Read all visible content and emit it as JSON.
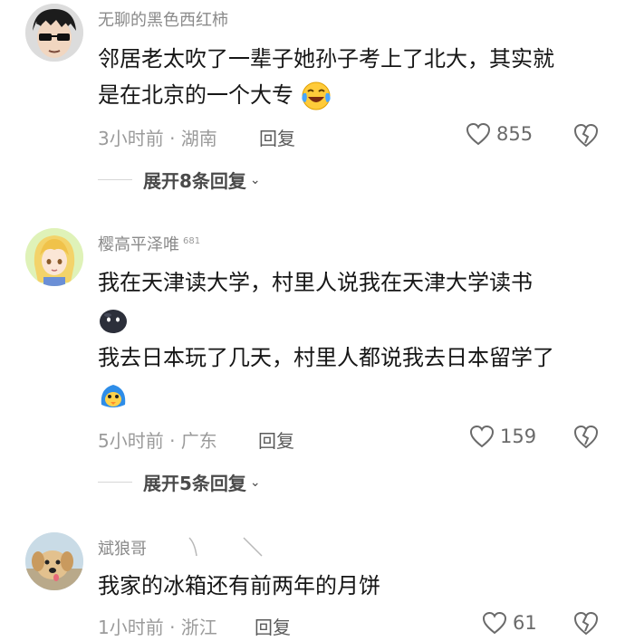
{
  "comments": [
    {
      "username": "无聊的黑色西红柿",
      "badge": "",
      "lines": [
        "邻居老太吹了一辈子她孙子考上了北大，其实就",
        "是在北京的一个大专"
      ],
      "time_location": "3小时前 · 湖南",
      "reply_label": "回复",
      "likes": "855",
      "expand_label": "展开8条回复",
      "emojis": [
        "laughing-tears-emoji"
      ]
    },
    {
      "username": "樱高平泽唯",
      "badge": "681",
      "lines": [
        "我在天津读大学，村里人说我在天津大学读书",
        "我去日本玩了几天，村里人都说我去日本留学了"
      ],
      "time_location": "5小时前 · 广东",
      "reply_label": "回复",
      "likes": "159",
      "expand_label": "展开5条回复",
      "emojis": [
        "black-blob-emoji",
        "blue-bird-emoji"
      ]
    },
    {
      "username": "斌狼哥",
      "badge": "",
      "lines": [
        "我家的冰箱还有前两年的月饼"
      ],
      "time_location": "1小时前 · 浙江",
      "reply_label": "回复",
      "likes": "61",
      "expand_label": "",
      "emojis": []
    }
  ],
  "colors": {
    "text": "#161616",
    "secondary": "#8a8a8a",
    "icon": "#6a6a6a"
  }
}
